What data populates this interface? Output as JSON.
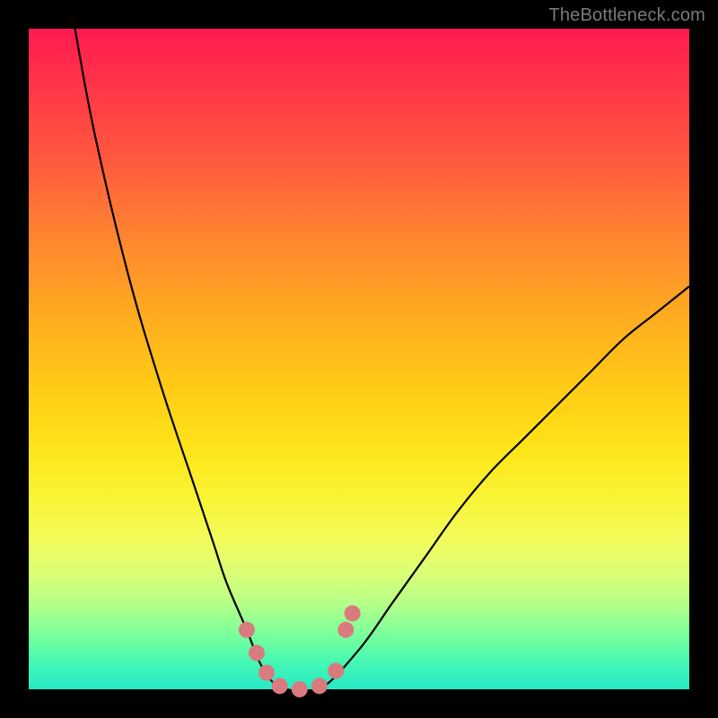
{
  "watermark": "TheBottleneck.com",
  "colors": {
    "frame": "#000000",
    "curve_stroke": "#000000",
    "marker_fill": "#d97a7f",
    "gradient_top": "#ff1a52",
    "gradient_bottom": "#27e9c6"
  },
  "chart_data": {
    "type": "line",
    "title": "",
    "xlabel": "",
    "ylabel": "",
    "xlim": [
      0,
      100
    ],
    "ylim": [
      0,
      100
    ],
    "grid": false,
    "series": [
      {
        "name": "bottleneck-curve",
        "x": [
          7,
          10,
          15,
          20,
          25,
          28,
          30,
          33,
          35,
          37,
          39,
          44,
          50,
          55,
          60,
          65,
          70,
          75,
          80,
          85,
          90,
          95,
          100
        ],
        "values": [
          100,
          84,
          63,
          46,
          31,
          22,
          16,
          9,
          4,
          1,
          0,
          0,
          6,
          13,
          20,
          27,
          33,
          38,
          43,
          48,
          53,
          57,
          61
        ]
      }
    ],
    "markers": [
      {
        "x": 33.0,
        "y": 9.0
      },
      {
        "x": 34.5,
        "y": 5.5
      },
      {
        "x": 36.0,
        "y": 2.5
      },
      {
        "x": 38.0,
        "y": 0.5
      },
      {
        "x": 41.0,
        "y": 0.0
      },
      {
        "x": 44.0,
        "y": 0.5
      },
      {
        "x": 46.5,
        "y": 2.8
      },
      {
        "x": 48.0,
        "y": 9.0
      },
      {
        "x": 49.0,
        "y": 11.5
      }
    ],
    "marker_radius_px": 9,
    "curve_stroke_px": 2.2
  }
}
